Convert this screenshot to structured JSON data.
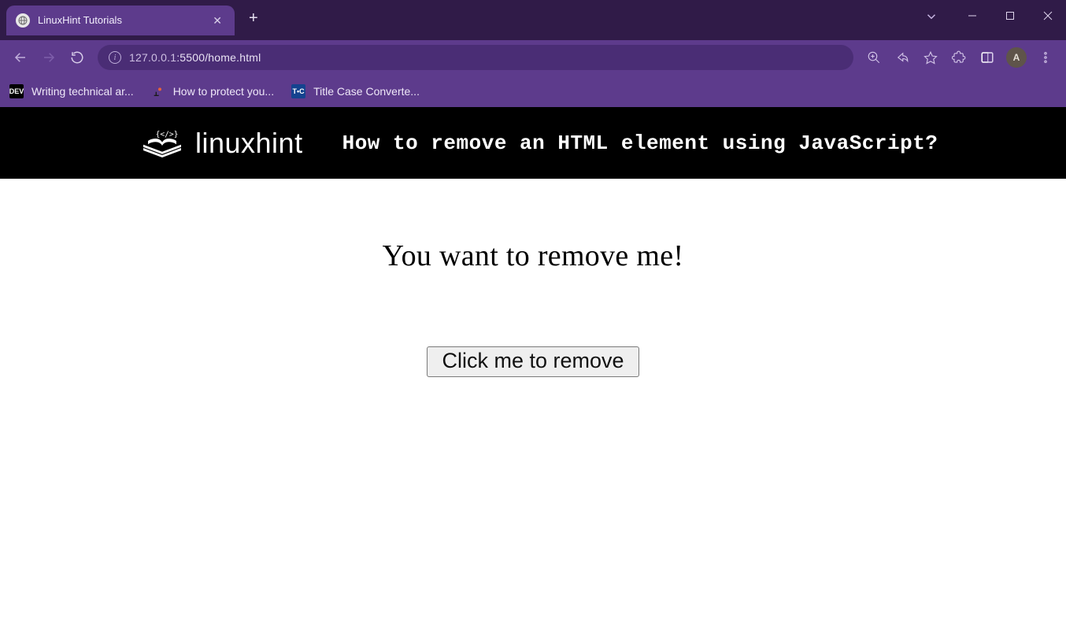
{
  "window": {
    "tab": {
      "title": "LinuxHint Tutorials"
    },
    "address": {
      "host": "127.0.0.1",
      "port_path": ":5500/home.html"
    },
    "avatar_letter": "A"
  },
  "bookmarks": [
    {
      "icon": "DEV",
      "label": "Writing technical ar..."
    },
    {
      "icon": "pin",
      "label": "How to protect you..."
    },
    {
      "icon": "TC",
      "label": "Title Case Converte..."
    }
  ],
  "page": {
    "brand": "linuxhint",
    "banner_title": "How to remove an HTML element using JavaScript?",
    "heading": "You want to remove me!",
    "button_label": "Click me to remove"
  }
}
